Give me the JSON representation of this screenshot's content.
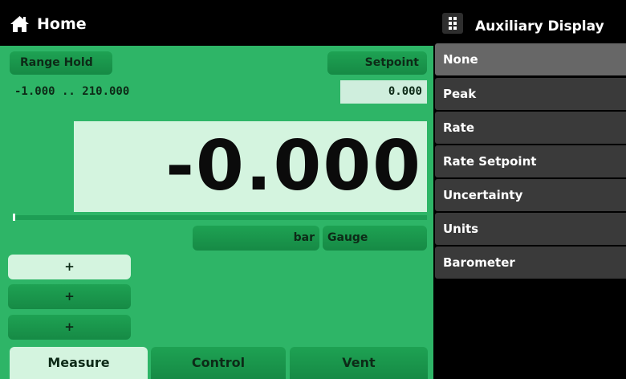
{
  "header": {
    "title": "Home",
    "icon": "home-icon"
  },
  "aux": {
    "title": "Auxiliary Display",
    "icon": "grid-icon",
    "items": [
      {
        "label": "None",
        "selected": true
      },
      {
        "label": "Peak"
      },
      {
        "label": "Rate"
      },
      {
        "label": "Rate Setpoint"
      },
      {
        "label": "Uncertainty"
      },
      {
        "label": "Units"
      },
      {
        "label": "Barometer"
      }
    ]
  },
  "main": {
    "range_hold_label": "Range Hold",
    "setpoint_label": "Setpoint",
    "range_text": "-1.000 .. 210.000",
    "setpoint_value": "0.000",
    "reading": "-0.000",
    "units": "bar",
    "mode": "Gauge",
    "plus_buttons": [
      "+",
      "+",
      "+"
    ],
    "tabs": [
      {
        "label": "Measure",
        "active": true
      },
      {
        "label": "Control"
      },
      {
        "label": "Vent"
      }
    ]
  },
  "colors": {
    "panel_green": "#2eb567",
    "button_green": "#1ea253",
    "light_green": "#d4f4df",
    "menu_item": "#3a3a3a",
    "menu_selected": "#676767"
  }
}
